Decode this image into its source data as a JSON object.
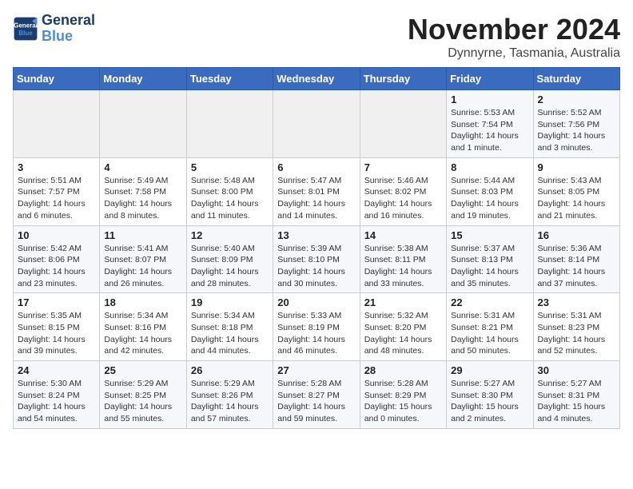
{
  "logo": {
    "line1": "General",
    "line2": "Blue"
  },
  "title": "November 2024",
  "location": "Dynnyrne, Tasmania, Australia",
  "weekdays": [
    "Sunday",
    "Monday",
    "Tuesday",
    "Wednesday",
    "Thursday",
    "Friday",
    "Saturday"
  ],
  "weeks": [
    [
      {
        "day": "",
        "detail": ""
      },
      {
        "day": "",
        "detail": ""
      },
      {
        "day": "",
        "detail": ""
      },
      {
        "day": "",
        "detail": ""
      },
      {
        "day": "",
        "detail": ""
      },
      {
        "day": "1",
        "detail": "Sunrise: 5:53 AM\nSunset: 7:54 PM\nDaylight: 14 hours\nand 1 minute."
      },
      {
        "day": "2",
        "detail": "Sunrise: 5:52 AM\nSunset: 7:56 PM\nDaylight: 14 hours\nand 3 minutes."
      }
    ],
    [
      {
        "day": "3",
        "detail": "Sunrise: 5:51 AM\nSunset: 7:57 PM\nDaylight: 14 hours\nand 6 minutes."
      },
      {
        "day": "4",
        "detail": "Sunrise: 5:49 AM\nSunset: 7:58 PM\nDaylight: 14 hours\nand 8 minutes."
      },
      {
        "day": "5",
        "detail": "Sunrise: 5:48 AM\nSunset: 8:00 PM\nDaylight: 14 hours\nand 11 minutes."
      },
      {
        "day": "6",
        "detail": "Sunrise: 5:47 AM\nSunset: 8:01 PM\nDaylight: 14 hours\nand 14 minutes."
      },
      {
        "day": "7",
        "detail": "Sunrise: 5:46 AM\nSunset: 8:02 PM\nDaylight: 14 hours\nand 16 minutes."
      },
      {
        "day": "8",
        "detail": "Sunrise: 5:44 AM\nSunset: 8:03 PM\nDaylight: 14 hours\nand 19 minutes."
      },
      {
        "day": "9",
        "detail": "Sunrise: 5:43 AM\nSunset: 8:05 PM\nDaylight: 14 hours\nand 21 minutes."
      }
    ],
    [
      {
        "day": "10",
        "detail": "Sunrise: 5:42 AM\nSunset: 8:06 PM\nDaylight: 14 hours\nand 23 minutes."
      },
      {
        "day": "11",
        "detail": "Sunrise: 5:41 AM\nSunset: 8:07 PM\nDaylight: 14 hours\nand 26 minutes."
      },
      {
        "day": "12",
        "detail": "Sunrise: 5:40 AM\nSunset: 8:09 PM\nDaylight: 14 hours\nand 28 minutes."
      },
      {
        "day": "13",
        "detail": "Sunrise: 5:39 AM\nSunset: 8:10 PM\nDaylight: 14 hours\nand 30 minutes."
      },
      {
        "day": "14",
        "detail": "Sunrise: 5:38 AM\nSunset: 8:11 PM\nDaylight: 14 hours\nand 33 minutes."
      },
      {
        "day": "15",
        "detail": "Sunrise: 5:37 AM\nSunset: 8:13 PM\nDaylight: 14 hours\nand 35 minutes."
      },
      {
        "day": "16",
        "detail": "Sunrise: 5:36 AM\nSunset: 8:14 PM\nDaylight: 14 hours\nand 37 minutes."
      }
    ],
    [
      {
        "day": "17",
        "detail": "Sunrise: 5:35 AM\nSunset: 8:15 PM\nDaylight: 14 hours\nand 39 minutes."
      },
      {
        "day": "18",
        "detail": "Sunrise: 5:34 AM\nSunset: 8:16 PM\nDaylight: 14 hours\nand 42 minutes."
      },
      {
        "day": "19",
        "detail": "Sunrise: 5:34 AM\nSunset: 8:18 PM\nDaylight: 14 hours\nand 44 minutes."
      },
      {
        "day": "20",
        "detail": "Sunrise: 5:33 AM\nSunset: 8:19 PM\nDaylight: 14 hours\nand 46 minutes."
      },
      {
        "day": "21",
        "detail": "Sunrise: 5:32 AM\nSunset: 8:20 PM\nDaylight: 14 hours\nand 48 minutes."
      },
      {
        "day": "22",
        "detail": "Sunrise: 5:31 AM\nSunset: 8:21 PM\nDaylight: 14 hours\nand 50 minutes."
      },
      {
        "day": "23",
        "detail": "Sunrise: 5:31 AM\nSunset: 8:23 PM\nDaylight: 14 hours\nand 52 minutes."
      }
    ],
    [
      {
        "day": "24",
        "detail": "Sunrise: 5:30 AM\nSunset: 8:24 PM\nDaylight: 14 hours\nand 54 minutes."
      },
      {
        "day": "25",
        "detail": "Sunrise: 5:29 AM\nSunset: 8:25 PM\nDaylight: 14 hours\nand 55 minutes."
      },
      {
        "day": "26",
        "detail": "Sunrise: 5:29 AM\nSunset: 8:26 PM\nDaylight: 14 hours\nand 57 minutes."
      },
      {
        "day": "27",
        "detail": "Sunrise: 5:28 AM\nSunset: 8:27 PM\nDaylight: 14 hours\nand 59 minutes."
      },
      {
        "day": "28",
        "detail": "Sunrise: 5:28 AM\nSunset: 8:29 PM\nDaylight: 15 hours\nand 0 minutes."
      },
      {
        "day": "29",
        "detail": "Sunrise: 5:27 AM\nSunset: 8:30 PM\nDaylight: 15 hours\nand 2 minutes."
      },
      {
        "day": "30",
        "detail": "Sunrise: 5:27 AM\nSunset: 8:31 PM\nDaylight: 15 hours\nand 4 minutes."
      }
    ]
  ]
}
